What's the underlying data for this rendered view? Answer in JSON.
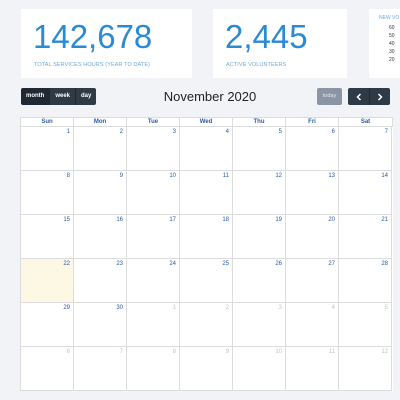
{
  "stats": [
    {
      "value": "142,678",
      "caption": "TOTAL SERVICES HOURS (YEAR TO DATE)"
    },
    {
      "value": "2,445",
      "caption": "ACTIVE VOLUNTEERS"
    }
  ],
  "mini_chart": {
    "title": "NEW VO",
    "ticks": [
      "60",
      "50",
      "40",
      "30",
      "20"
    ]
  },
  "toolbar": {
    "month_label": "month",
    "week_label": "week",
    "day_label": "day",
    "title": "November 2020",
    "today_label": "today"
  },
  "calendar": {
    "weekdays": [
      "Sun",
      "Mon",
      "Tue",
      "Wed",
      "Thu",
      "Fri",
      "Sat"
    ],
    "weeks": [
      [
        {
          "d": "1",
          "o": false
        },
        {
          "d": "2",
          "o": false
        },
        {
          "d": "3",
          "o": false
        },
        {
          "d": "4",
          "o": false
        },
        {
          "d": "5",
          "o": false
        },
        {
          "d": "6",
          "o": false
        },
        {
          "d": "7",
          "o": false
        }
      ],
      [
        {
          "d": "8",
          "o": false
        },
        {
          "d": "9",
          "o": false
        },
        {
          "d": "10",
          "o": false
        },
        {
          "d": "11",
          "o": false
        },
        {
          "d": "12",
          "o": false
        },
        {
          "d": "13",
          "o": false
        },
        {
          "d": "14",
          "o": false
        }
      ],
      [
        {
          "d": "15",
          "o": false
        },
        {
          "d": "16",
          "o": false
        },
        {
          "d": "17",
          "o": false
        },
        {
          "d": "18",
          "o": false
        },
        {
          "d": "19",
          "o": false
        },
        {
          "d": "20",
          "o": false
        },
        {
          "d": "21",
          "o": false
        }
      ],
      [
        {
          "d": "22",
          "o": false,
          "today": true
        },
        {
          "d": "23",
          "o": false
        },
        {
          "d": "24",
          "o": false
        },
        {
          "d": "25",
          "o": false
        },
        {
          "d": "26",
          "o": false
        },
        {
          "d": "27",
          "o": false
        },
        {
          "d": "28",
          "o": false
        }
      ],
      [
        {
          "d": "29",
          "o": false
        },
        {
          "d": "30",
          "o": false
        },
        {
          "d": "1",
          "o": true
        },
        {
          "d": "2",
          "o": true
        },
        {
          "d": "3",
          "o": true
        },
        {
          "d": "4",
          "o": true
        },
        {
          "d": "5",
          "o": true
        }
      ],
      [
        {
          "d": "6",
          "o": true
        },
        {
          "d": "7",
          "o": true
        },
        {
          "d": "8",
          "o": true
        },
        {
          "d": "9",
          "o": true
        },
        {
          "d": "10",
          "o": true
        },
        {
          "d": "11",
          "o": true
        },
        {
          "d": "12",
          "o": true
        }
      ]
    ]
  }
}
